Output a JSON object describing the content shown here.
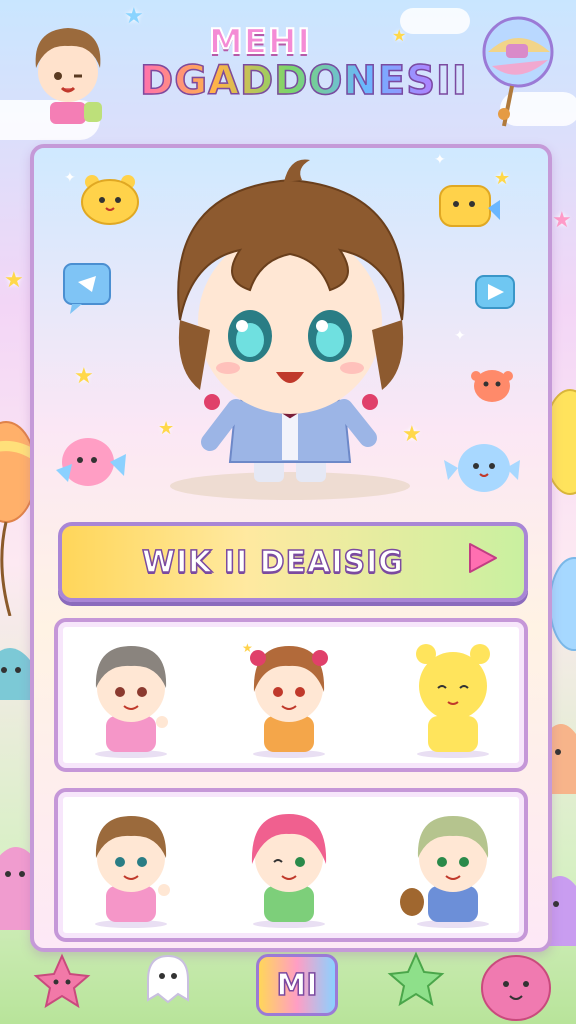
{
  "header": {
    "title_line1": "MEHI",
    "title_line2": "DGADDONESII"
  },
  "main": {
    "cta_label": "WIK II DEAISIG"
  },
  "roster": {
    "row1": [
      "brown-haired-boy-pink",
      "red-haired-girl-orange",
      "yellow-bear-character"
    ],
    "row2": [
      "brown-haired-boy-pink-waving",
      "pink-haired-girl-green",
      "green-haired-boy-blue"
    ]
  },
  "bottom_bar": {
    "logo_text": "MI"
  },
  "colors": {
    "card_border": "#c59ad8",
    "cta_start": "#ffd65a",
    "cta_end": "#c9f0a0",
    "accent_purple": "#7b4aa0"
  }
}
